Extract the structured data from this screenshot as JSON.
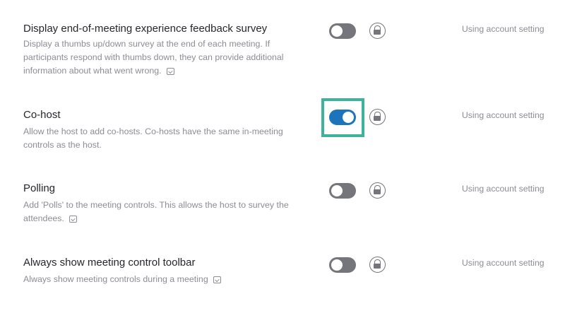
{
  "settings": [
    {
      "title": "Display end-of-meeting experience feedback survey",
      "description": "Display a thumbs up/down survey at the end of each meeting. If participants respond with thumbs down, they can provide additional information about what went wrong.",
      "enabled": false,
      "status": "Using account setting"
    },
    {
      "title": "Co-host",
      "description": "Allow the host to add co-hosts. Co-hosts have the same in-meeting controls as the host.",
      "enabled": true,
      "highlighted": true,
      "status": "Using account setting"
    },
    {
      "title": "Polling",
      "description": "Add 'Polls' to the meeting controls. This allows the host to survey the attendees.",
      "enabled": false,
      "status": "Using account setting"
    },
    {
      "title": "Always show meeting control toolbar",
      "description": "Always show meeting controls during a meeting",
      "enabled": false,
      "status": "Using account setting"
    }
  ],
  "colors": {
    "toggle_on": "#1c75bc",
    "toggle_off": "#75757c",
    "highlight_border": "#3db39a",
    "description_text": "#8c8c94"
  },
  "icons": {
    "lock": "lock-icon",
    "info": "info-icon"
  }
}
